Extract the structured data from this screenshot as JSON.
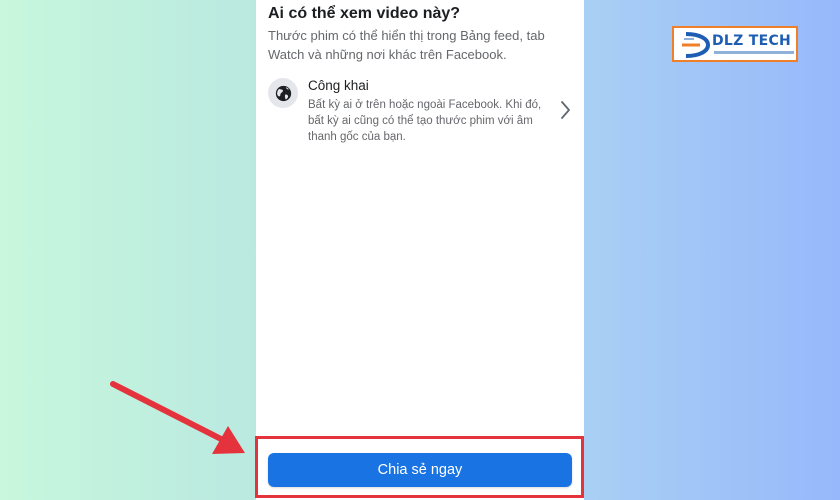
{
  "visibility": {
    "question": "Ai có thể xem video này?",
    "description": "Thước phim có thể hiển thị trong Bảng feed, tab Watch và những nơi khác trên Facebook."
  },
  "option": {
    "icon": "globe-icon",
    "title": "Công khai",
    "description": "Bất kỳ ai ở trên hoặc ngoài Facebook. Khi đó, bất kỳ ai cũng có thể tạo thước phim với âm thanh gốc của bạn."
  },
  "action": {
    "share_label": "Chia sẻ ngay",
    "button_color": "#1a73e3"
  },
  "annotation": {
    "highlight_color": "#e5333d"
  },
  "watermark": {
    "text": "DLZ TECH"
  }
}
